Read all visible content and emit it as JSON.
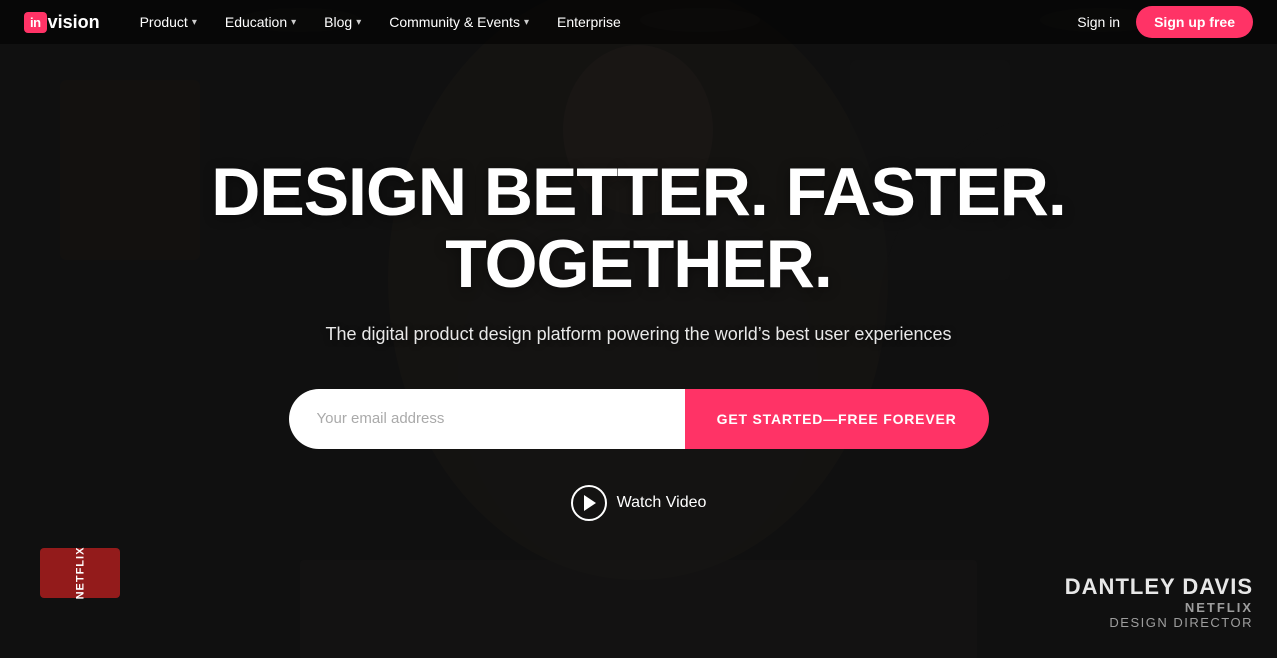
{
  "logo": {
    "in_badge": "in",
    "vision_text": "vision"
  },
  "nav": {
    "items": [
      {
        "id": "product",
        "label": "Product",
        "has_dropdown": true
      },
      {
        "id": "education",
        "label": "Education",
        "has_dropdown": true
      },
      {
        "id": "blog",
        "label": "Blog",
        "has_dropdown": true
      },
      {
        "id": "community",
        "label": "Community & Events",
        "has_dropdown": true
      },
      {
        "id": "enterprise",
        "label": "Enterprise",
        "has_dropdown": false
      }
    ],
    "sign_in": "Sign in",
    "sign_up": "Sign up free"
  },
  "hero": {
    "headline": "DESIGN BETTER. FASTER. TOGETHER.",
    "subheadline": "The digital product design platform powering the world’s best user experiences",
    "email_placeholder": "Your email address",
    "cta_label": "GET STARTED—FREE FOREVER",
    "watch_video_label": "Watch Video"
  },
  "attribution": {
    "name": "DANTLEY DAVIS",
    "company": "NETFLIX",
    "role": "DESIGN DIRECTOR"
  },
  "colors": {
    "brand_red": "#ff3366",
    "nav_bg": "rgba(0,0,0,0.55)"
  }
}
